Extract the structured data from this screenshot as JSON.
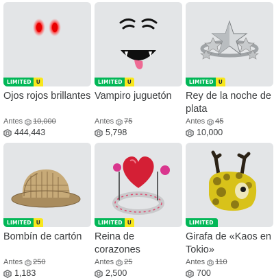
{
  "labels": {
    "limited": "LIMITED",
    "unique": "U",
    "before": "Antes"
  },
  "colors": {
    "limited_green": "#02b757",
    "unique_yellow": "#f8e71c",
    "thumb_bg": "#e3e5e7"
  },
  "items": [
    {
      "name": "Ojos rojos brillantes",
      "old_price": "10,000",
      "price": "444,443",
      "badge_unique": true
    },
    {
      "name": "Vampiro juguetón",
      "old_price": "75",
      "price": "5,798",
      "badge_unique": true
    },
    {
      "name": "Rey de la noche de plata",
      "old_price": "45",
      "price": "10,000",
      "badge_unique": true
    },
    {
      "name": "Bombín de cartón",
      "old_price": "250",
      "price": "1,183",
      "badge_unique": true
    },
    {
      "name": "Reina de corazones",
      "old_price": "25",
      "price": "2,500",
      "badge_unique": true
    },
    {
      "name": "Girafa de «Kaos en Tokio»",
      "old_price": "110",
      "price": "700",
      "badge_unique": false
    }
  ],
  "icons": {
    "currency": "robux-icon"
  }
}
